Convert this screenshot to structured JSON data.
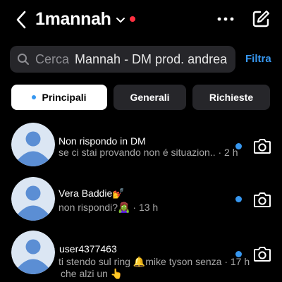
{
  "header": {
    "username": "1mannah",
    "back_icon": "chevron-left-icon",
    "dropdown_icon": "chevron-down-icon",
    "more_icon": "more-horizontal-icon",
    "compose_icon": "new-message-icon",
    "status_dot_color": "#ff3040"
  },
  "search": {
    "placeholder": "Cerca",
    "value": "Mannah - DM prod. andrea",
    "icon": "search-icon",
    "filter_label": "Filtra"
  },
  "tabs": [
    {
      "label": "Principali",
      "active": true
    },
    {
      "label": "Generali",
      "active": false
    },
    {
      "label": "Richieste",
      "active": false
    }
  ],
  "conversations": [
    {
      "name": "Non rispondo in DM",
      "preview": "se ci stai provando non é situazion..",
      "preview_extra": "",
      "time": "2 h",
      "unread": true
    },
    {
      "name": "Vera Baddie💅",
      "preview": "non rispondi?🧟‍♀️",
      "preview_extra": "",
      "time": "13 h",
      "unread": true
    },
    {
      "name": "user4377463",
      "preview": "ti stendo sul ring 🔔mike tyson senza",
      "preview_extra": "che alzi un 👆",
      "time": "17 h",
      "unread": true
    }
  ],
  "colors": {
    "accent": "#3797f0",
    "unread_dot": "#3797f0",
    "background": "#000000",
    "surface": "#26262a"
  }
}
